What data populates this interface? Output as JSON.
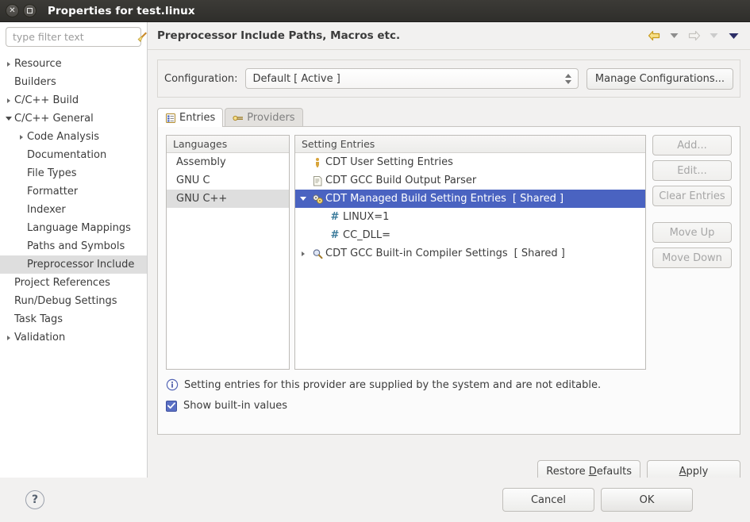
{
  "window": {
    "title": "Properties for test.linux",
    "close_icon": "close-icon",
    "maximize_icon": "maximize-icon"
  },
  "filter": {
    "placeholder": "type filter text",
    "clear_icon": "broom-icon"
  },
  "sidebar": {
    "items": [
      {
        "label": "Resource",
        "indent": 0,
        "arrow": "collapsed",
        "selected": false
      },
      {
        "label": "Builders",
        "indent": 0,
        "arrow": "none",
        "selected": false
      },
      {
        "label": "C/C++ Build",
        "indent": 0,
        "arrow": "collapsed",
        "selected": false
      },
      {
        "label": "C/C++ General",
        "indent": 0,
        "arrow": "expanded",
        "selected": false
      },
      {
        "label": "Code Analysis",
        "indent": 1,
        "arrow": "collapsed",
        "selected": false
      },
      {
        "label": "Documentation",
        "indent": 1,
        "arrow": "none",
        "selected": false
      },
      {
        "label": "File Types",
        "indent": 1,
        "arrow": "none",
        "selected": false
      },
      {
        "label": "Formatter",
        "indent": 1,
        "arrow": "none",
        "selected": false
      },
      {
        "label": "Indexer",
        "indent": 1,
        "arrow": "none",
        "selected": false
      },
      {
        "label": "Language Mappings",
        "indent": 1,
        "arrow": "none",
        "selected": false
      },
      {
        "label": "Paths and Symbols",
        "indent": 1,
        "arrow": "none",
        "selected": false
      },
      {
        "label": "Preprocessor Include",
        "indent": 1,
        "arrow": "none",
        "selected": true
      },
      {
        "label": "Project References",
        "indent": 0,
        "arrow": "none",
        "selected": false
      },
      {
        "label": "Run/Debug Settings",
        "indent": 0,
        "arrow": "none",
        "selected": false
      },
      {
        "label": "Task Tags",
        "indent": 0,
        "arrow": "none",
        "selected": false
      },
      {
        "label": "Validation",
        "indent": 0,
        "arrow": "collapsed",
        "selected": false
      }
    ]
  },
  "page": {
    "title": "Preprocessor Include Paths, Macros etc.",
    "nav": {
      "back_icon": "back-arrow-icon",
      "back_menu_icon": "chevron-down-icon",
      "forward_icon": "forward-arrow-icon",
      "forward_menu_icon": "chevron-down-icon",
      "view_menu_icon": "chevron-down-icon"
    }
  },
  "configuration": {
    "label": "Configuration:",
    "value": "Default  [ Active ]",
    "spinner_icon": "spinner-updown-icon",
    "manage_button": "Manage Configurations..."
  },
  "tabs": [
    {
      "label": "Entries",
      "icon": "entries-icon",
      "active": true
    },
    {
      "label": "Providers",
      "icon": "providers-icon",
      "active": false
    }
  ],
  "languages": {
    "header": "Languages",
    "items": [
      {
        "label": "Assembly",
        "selected": false
      },
      {
        "label": "GNU C",
        "selected": false
      },
      {
        "label": "GNU C++",
        "selected": true
      }
    ]
  },
  "entries": {
    "header": "Setting Entries",
    "rows": [
      {
        "label": "CDT User Setting Entries",
        "badge": "",
        "icon": "person-icon",
        "expander": "none",
        "indent": 0,
        "selected": false
      },
      {
        "label": "CDT GCC Build Output Parser",
        "badge": "",
        "icon": "document-icon",
        "expander": "none",
        "indent": 0,
        "selected": false
      },
      {
        "label": "CDT Managed Build Setting Entries",
        "badge": "[ Shared ]",
        "icon": "gears-icon",
        "expander": "expanded",
        "indent": 0,
        "selected": true
      },
      {
        "label": "LINUX=1",
        "badge": "",
        "icon": "macro-hash",
        "expander": "none",
        "indent": 1,
        "selected": false
      },
      {
        "label": "CC_DLL=",
        "badge": "",
        "icon": "macro-hash",
        "expander": "none",
        "indent": 1,
        "selected": false
      },
      {
        "label": "CDT GCC Built-in Compiler Settings",
        "badge": "[ Shared ]",
        "icon": "magnifier-icon",
        "expander": "collapsed",
        "indent": 0,
        "selected": false
      }
    ]
  },
  "entry_buttons": [
    {
      "label": "Add...",
      "enabled": false
    },
    {
      "label": "Edit...",
      "enabled": false
    },
    {
      "label": "Clear Entries",
      "enabled": false
    },
    {
      "label": "Move Up",
      "enabled": false
    },
    {
      "label": "Move Down",
      "enabled": false
    }
  ],
  "info": {
    "icon": "info-icon",
    "text": "Setting entries for this provider are supplied by the system and are not editable."
  },
  "show_builtin": {
    "label": "Show built-in values",
    "checked": true
  },
  "page_actions": [
    {
      "label": "Restore Defaults",
      "mnemonic": "D"
    },
    {
      "label": "Apply",
      "mnemonic": "A"
    }
  ],
  "footer": {
    "help_icon": "help-icon",
    "cancel": "Cancel",
    "ok": "OK"
  },
  "colors": {
    "selection_blue": "#4a63c1",
    "sidebar_selection": "#dedede",
    "scrollbar_blue": "#4f63c4",
    "window_bg": "#f2f1f0",
    "titlebar": "#35342f"
  }
}
